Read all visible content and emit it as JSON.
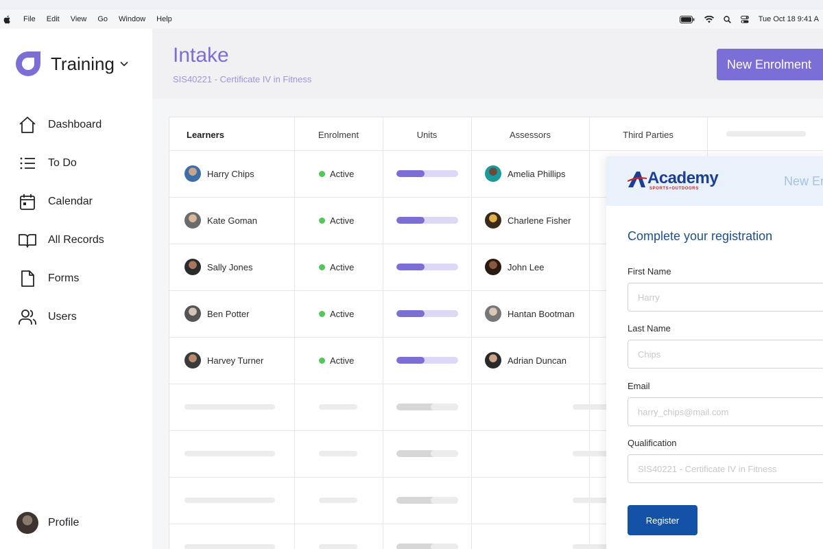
{
  "menubar": {
    "items": [
      "File",
      "Edit",
      "View",
      "Go",
      "Window",
      "Help"
    ],
    "datetime": "Tue Oct 18  9:41 A"
  },
  "sidebar": {
    "brand": "Training",
    "nav": [
      {
        "label": "Dashboard",
        "icon": "home-icon"
      },
      {
        "label": "To Do",
        "icon": "list-icon"
      },
      {
        "label": "Calendar",
        "icon": "calendar-icon"
      },
      {
        "label": "All Records",
        "icon": "book-icon"
      },
      {
        "label": "Forms",
        "icon": "document-icon"
      },
      {
        "label": "Users",
        "icon": "users-icon"
      }
    ],
    "profile_label": "Profile"
  },
  "header": {
    "title": "Intake",
    "subtitle": "SIS40221 - Certificate IV in Fitness",
    "new_button": "New Enrolment"
  },
  "table": {
    "columns": [
      "Learners",
      "Enrolment",
      "Units",
      "Assessors",
      "Third Parties"
    ],
    "rows": [
      {
        "learner": "Harry Chips",
        "enrolment": "Active",
        "units_progress": 0.45,
        "assessor": "Amelia Phillips"
      },
      {
        "learner": "Kate Goman",
        "enrolment": "Active",
        "units_progress": 0.45,
        "assessor": "Charlene Fisher"
      },
      {
        "learner": "Sally Jones",
        "enrolment": "Active",
        "units_progress": 0.45,
        "assessor": "John Lee"
      },
      {
        "learner": "Ben Potter",
        "enrolment": "Active",
        "units_progress": 0.45,
        "assessor": "Hantan Bootman"
      },
      {
        "learner": "Harvey Turner",
        "enrolment": "Active",
        "units_progress": 0.45,
        "assessor": "Adrian Duncan"
      }
    ]
  },
  "colors": {
    "accent": "#7b6fd6",
    "active": "#52c85a",
    "form_primary": "#1452a8"
  },
  "form": {
    "brand": "Academy",
    "brand_sub": "SPORTS+OUTDOORS",
    "header_right": "New En",
    "title": "Complete your registration",
    "first_name_label": "First Name",
    "first_name_placeholder": "Harry",
    "last_name_label": "Last Name",
    "last_name_placeholder": "Chips",
    "email_label": "Email",
    "email_placeholder": "harry_chips@mail.com",
    "qualification_label": "Qualification",
    "qualification_placeholder": "SIS40221 - Certificate IV in Fitness",
    "register_button": "Register"
  }
}
